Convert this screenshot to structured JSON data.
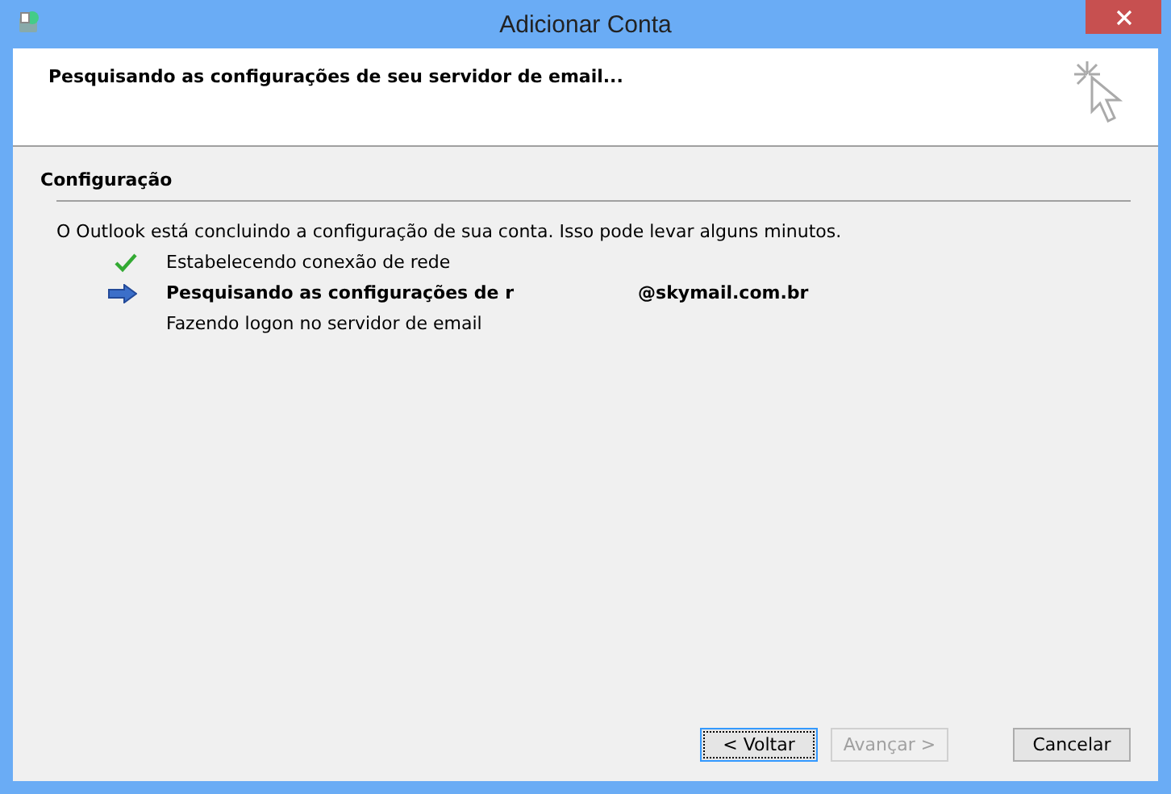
{
  "window": {
    "title": "Adicionar Conta"
  },
  "header": {
    "title": "Pesquisando as configurações de seu servidor de email..."
  },
  "section": {
    "title": "Configuração"
  },
  "message": "O Outlook está concluindo a configuração de sua conta. Isso pode levar alguns minutos.",
  "steps": [
    {
      "kind": "done",
      "text": "Estabelecendo conexão de rede"
    },
    {
      "kind": "current",
      "text": "Pesquisando as configurações de r",
      "text_2": "@skymail.com.br"
    },
    {
      "kind": "pending",
      "text": "Fazendo logon no servidor de email"
    }
  ],
  "buttons": [
    {
      "label": "< Voltar",
      "disabled": false,
      "focused": true
    },
    {
      "label": "Avançar >",
      "disabled": true,
      "focused": false
    },
    {
      "label": "Cancelar",
      "disabled": false,
      "focused": false
    }
  ]
}
